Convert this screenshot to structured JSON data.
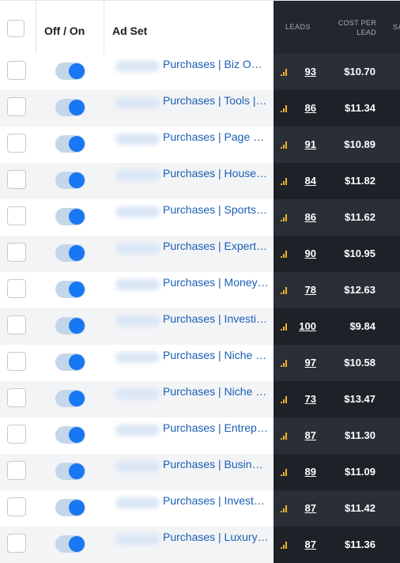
{
  "header": {
    "off_on": "Off / On",
    "ad_set": "Ad Set",
    "leads": "LEADS",
    "cost_per_lead_line1": "COST PER",
    "cost_per_lead_line2": "LEAD",
    "truncated_col": "SA"
  },
  "rows": [
    {
      "ad_set": "Purchases | Biz Ow…",
      "leads": "93",
      "cost_per_lead": "$10.70"
    },
    {
      "ad_set": "Purchases | Tools | …",
      "leads": "86",
      "cost_per_lead": "$11.34"
    },
    {
      "ad_set": "Purchases | Page a…",
      "leads": "91",
      "cost_per_lead": "$10.89"
    },
    {
      "ad_set": "Purchases | Househ…",
      "leads": "84",
      "cost_per_lead": "$11.82"
    },
    {
      "ad_set": "Purchases | Sports…",
      "leads": "86",
      "cost_per_lead": "$11.62"
    },
    {
      "ad_set": "Purchases | Experts…",
      "leads": "90",
      "cost_per_lead": "$10.95"
    },
    {
      "ad_set": "Purchases | Money-…",
      "leads": "78",
      "cost_per_lead": "$12.63"
    },
    {
      "ad_set": "Purchases | Investin…",
      "leads": "100",
      "cost_per_lead": "$9.84"
    },
    {
      "ad_set": "Purchases | Niche | …",
      "leads": "97",
      "cost_per_lead": "$10.58"
    },
    {
      "ad_set": "Purchases | Niche | …",
      "leads": "73",
      "cost_per_lead": "$13.47"
    },
    {
      "ad_set": "Purchases | Entrepr…",
      "leads": "87",
      "cost_per_lead": "$11.30"
    },
    {
      "ad_set": "Purchases | Busine…",
      "leads": "89",
      "cost_per_lead": "$11.09"
    },
    {
      "ad_set": "Purchases | Investo…",
      "leads": "87",
      "cost_per_lead": "$11.42"
    },
    {
      "ad_set": "Purchases | Luxury |…",
      "leads": "87",
      "cost_per_lead": "$11.36"
    }
  ],
  "colors": {
    "toggle_on": "#1877f2",
    "link": "#1a5fb4",
    "dark_panel": "#22262e",
    "signal_icon": "#f0b429"
  }
}
